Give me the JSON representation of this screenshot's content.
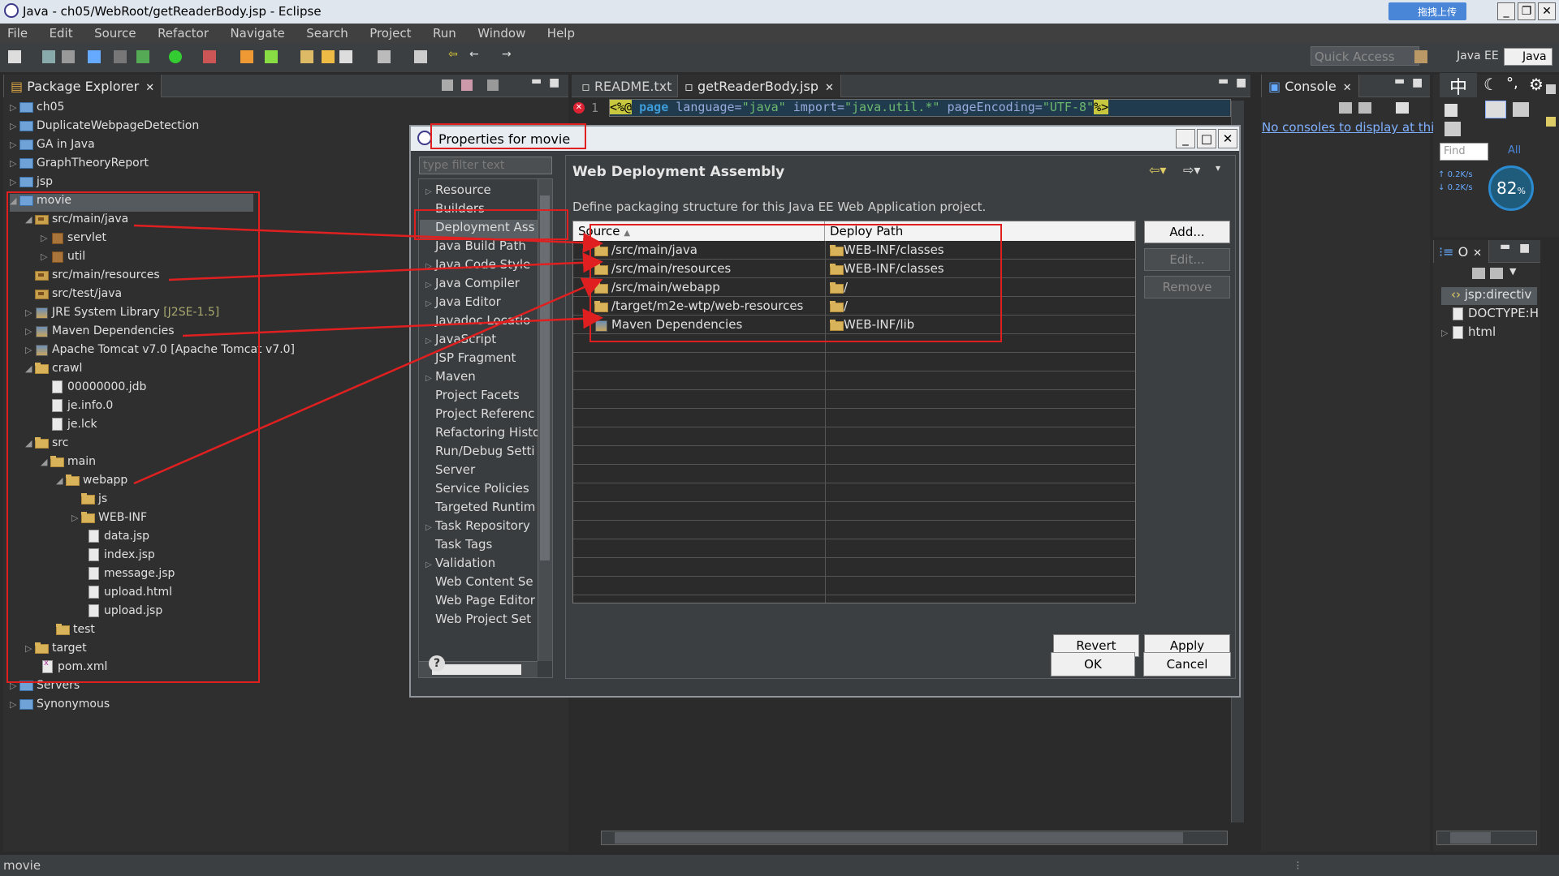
{
  "window": {
    "title": "Java - ch05/WebRoot/getReaderBody.jsp - Eclipse",
    "badge": "拖拽上传"
  },
  "menu": [
    "File",
    "Edit",
    "Source",
    "Refactor",
    "Navigate",
    "Search",
    "Project",
    "Run",
    "Window",
    "Help"
  ],
  "toolbar": {
    "quick_access": "Quick Access",
    "persp_javaee": "Java EE",
    "persp_java": "Java"
  },
  "package_explorer": {
    "title": "Package Explorer",
    "items": [
      {
        "label": "ch05"
      },
      {
        "label": "DuplicateWebpageDetection"
      },
      {
        "label": "GA in Java"
      },
      {
        "label": "GraphTheoryReport"
      },
      {
        "label": "jsp"
      },
      {
        "label": "movie"
      },
      {
        "label": "src/main/java"
      },
      {
        "label": "servlet"
      },
      {
        "label": "util"
      },
      {
        "label": "src/main/resources"
      },
      {
        "label": "src/test/java"
      },
      {
        "label": "JRE System Library",
        "extra": "[J2SE-1.5]"
      },
      {
        "label": "Maven Dependencies"
      },
      {
        "label": "Apache Tomcat v7.0 [Apache Tomcat v7.0]"
      },
      {
        "label": "crawl"
      },
      {
        "label": "00000000.jdb"
      },
      {
        "label": "je.info.0"
      },
      {
        "label": "je.lck"
      },
      {
        "label": "src"
      },
      {
        "label": "main"
      },
      {
        "label": "webapp"
      },
      {
        "label": "js"
      },
      {
        "label": "WEB-INF"
      },
      {
        "label": "data.jsp"
      },
      {
        "label": "index.jsp"
      },
      {
        "label": "message.jsp"
      },
      {
        "label": "upload.html"
      },
      {
        "label": "upload.jsp"
      },
      {
        "label": "test"
      },
      {
        "label": "target"
      },
      {
        "label": "pom.xml"
      },
      {
        "label": "Servers"
      },
      {
        "label": "Synonymous"
      }
    ]
  },
  "editor": {
    "tabs": [
      {
        "label": "README.txt"
      },
      {
        "label": "getReaderBody.jsp"
      }
    ],
    "line_no": "1",
    "code": {
      "open": "<%@",
      "kw": "page",
      "a1": "language=",
      "v1": "\"java\"",
      "a2": "import=",
      "v2": "\"java.util.*\"",
      "a3": "pageEncoding=",
      "v3": "\"UTF-8\"",
      "close": "%>"
    }
  },
  "console": {
    "title": "Console",
    "message": "No consoles to display at thi"
  },
  "outline": {
    "title": "O",
    "find_placeholder": "Find",
    "all_label": "All",
    "items": [
      {
        "label": "jsp:directiv"
      },
      {
        "label": "DOCTYPE:H"
      },
      {
        "label": "html"
      }
    ]
  },
  "ime": {
    "glyph": "中",
    "speed_up": "0.2K/s",
    "speed_down": "0.2K/s",
    "percent": "82",
    "percent_unit": "%"
  },
  "dialog": {
    "title": "Properties for movie",
    "filter_placeholder": "type filter text",
    "nav": [
      {
        "label": "Resource",
        "expandable": true
      },
      {
        "label": "Builders",
        "expandable": false
      },
      {
        "label": "Deployment Ass",
        "expandable": false,
        "selected": true
      },
      {
        "label": "Java Build Path",
        "expandable": false
      },
      {
        "label": "Java Code Style",
        "expandable": true
      },
      {
        "label": "Java Compiler",
        "expandable": true
      },
      {
        "label": "Java Editor",
        "expandable": true
      },
      {
        "label": "Javadoc Locatio",
        "expandable": false
      },
      {
        "label": "JavaScript",
        "expandable": true
      },
      {
        "label": "JSP Fragment",
        "expandable": false
      },
      {
        "label": "Maven",
        "expandable": true
      },
      {
        "label": "Project Facets",
        "expandable": false
      },
      {
        "label": "Project Referenc",
        "expandable": false
      },
      {
        "label": "Refactoring Histo",
        "expandable": false
      },
      {
        "label": "Run/Debug Setti",
        "expandable": false
      },
      {
        "label": "Server",
        "expandable": false
      },
      {
        "label": "Service Policies",
        "expandable": false
      },
      {
        "label": "Targeted Runtim",
        "expandable": false
      },
      {
        "label": "Task Repository",
        "expandable": true
      },
      {
        "label": "Task Tags",
        "expandable": false
      },
      {
        "label": "Validation",
        "expandable": true
      },
      {
        "label": "Web Content Se",
        "expandable": false
      },
      {
        "label": "Web Page Editor",
        "expandable": false
      },
      {
        "label": "Web Project Set",
        "expandable": false
      }
    ],
    "page_title": "Web Deployment Assembly",
    "description": "Define packaging structure for this Java EE Web Application project.",
    "columns": {
      "source": "Source",
      "deploy": "Deploy Path"
    },
    "rows": [
      {
        "source": "/src/main/java",
        "deploy": "WEB-INF/classes"
      },
      {
        "source": "/src/main/resources",
        "deploy": "WEB-INF/classes"
      },
      {
        "source": "/src/main/webapp",
        "deploy": "/"
      },
      {
        "source": "/target/m2e-wtp/web-resources",
        "deploy": "/"
      },
      {
        "source": "Maven Dependencies",
        "deploy": "WEB-INF/lib"
      }
    ],
    "buttons": {
      "add": "Add...",
      "edit": "Edit...",
      "remove": "Remove",
      "revert": "Revert",
      "apply": "Apply",
      "ok": "OK",
      "cancel": "Cancel"
    }
  },
  "status": {
    "text": "movie"
  },
  "colors": {
    "annotation": "#e02020",
    "background": "#2b2b2b",
    "dialog_bg": "#3a3d3f"
  }
}
